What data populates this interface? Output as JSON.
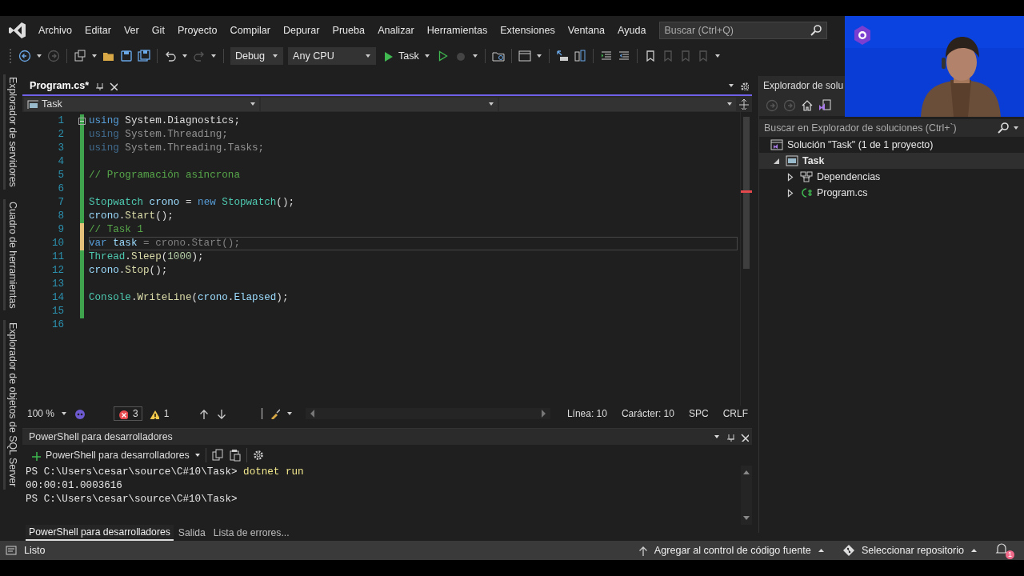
{
  "menu": [
    "Archivo",
    "Editar",
    "Ver",
    "Git",
    "Proyecto",
    "Compilar",
    "Depurar",
    "Prueba",
    "Analizar",
    "Herramientas",
    "Extensiones",
    "Ventana",
    "Ayuda"
  ],
  "search": {
    "placeholder": "Buscar (Ctrl+Q)"
  },
  "toolbar": {
    "configuration": "Debug",
    "platform": "Any CPU",
    "run_target": "Task"
  },
  "side_tabs": [
    "Explorador de servidores",
    "Cuadro de herramientas",
    "Explorador de objetos de SQL Server"
  ],
  "editor": {
    "tab": {
      "label": "Program.cs*",
      "selected": true
    },
    "nav": "Task",
    "lines": [
      {
        "number": "1",
        "color": "#3fa34d",
        "collapsible": true,
        "unused": false,
        "current": false,
        "tokens": [
          {
            "t": "using",
            "kind": "kw"
          },
          {
            "t": " System.Diagnostics;",
            "kind": "plain"
          }
        ]
      },
      {
        "number": "2",
        "color": "#3fa34d",
        "unused": true,
        "current": false,
        "tokens": [
          {
            "t": "using",
            "kind": "kw"
          },
          {
            "t": " System.Threading;",
            "kind": "plain"
          }
        ]
      },
      {
        "number": "3",
        "color": "#3fa34d",
        "unused": true,
        "current": false,
        "tokens": [
          {
            "t": "using",
            "kind": "kw"
          },
          {
            "t": " System.Threading.Tasks;",
            "kind": "plain"
          }
        ]
      },
      {
        "number": "4",
        "color": "#3fa34d"
      },
      {
        "number": "5",
        "color": "#3fa34d",
        "unused": false,
        "current": false,
        "tokens": [
          {
            "t": "// Programación asíncrona",
            "kind": "comment"
          }
        ]
      },
      {
        "number": "6",
        "color": "#3fa34d"
      },
      {
        "number": "7",
        "color": "#3fa34d",
        "unused": false,
        "current": false,
        "tokens": [
          {
            "t": "Stopwatch",
            "kind": "type"
          },
          {
            "t": " crono",
            "kind": "ident"
          },
          {
            "t": " = ",
            "kind": "plain"
          },
          {
            "t": "new",
            "kind": "kw"
          },
          {
            "t": " Stopwatch",
            "kind": "type"
          },
          {
            "t": "();",
            "kind": "plain"
          }
        ]
      },
      {
        "number": "8",
        "color": "#3fa34d",
        "unused": false,
        "current": false,
        "tokens": [
          {
            "t": "crono",
            "kind": "ident"
          },
          {
            "t": ".",
            "kind": "plain"
          },
          {
            "t": "Start",
            "kind": "method"
          },
          {
            "t": "();",
            "kind": "plain"
          }
        ]
      },
      {
        "number": "9",
        "color": "#e5c07b",
        "unused": false,
        "current": false,
        "tokens": [
          {
            "t": "// Task 1",
            "kind": "comment"
          }
        ]
      },
      {
        "number": "10",
        "color": "#e5c07b",
        "unused": false,
        "current": true,
        "tokens": [
          {
            "t": "var",
            "kind": "kw"
          },
          {
            "t": " task",
            "kind": "ident"
          },
          {
            "t": " = crono.Start();",
            "kind": "ghost"
          }
        ]
      },
      {
        "number": "11",
        "color": "#3fa34d",
        "unused": false,
        "current": false,
        "tokens": [
          {
            "t": "Thread",
            "kind": "type"
          },
          {
            "t": ".",
            "kind": "plain"
          },
          {
            "t": "Sleep",
            "kind": "method"
          },
          {
            "t": "(",
            "kind": "plain"
          },
          {
            "t": "1000",
            "kind": "num"
          },
          {
            "t": ");",
            "kind": "plain"
          }
        ]
      },
      {
        "number": "12",
        "color": "#3fa34d",
        "unused": false,
        "current": false,
        "tokens": [
          {
            "t": "crono",
            "kind": "ident"
          },
          {
            "t": ".",
            "kind": "plain"
          },
          {
            "t": "Stop",
            "kind": "method"
          },
          {
            "t": "();",
            "kind": "plain"
          }
        ]
      },
      {
        "number": "13",
        "color": "#3fa34d"
      },
      {
        "number": "14",
        "color": "#3fa34d",
        "unused": false,
        "current": false,
        "tokens": [
          {
            "t": "Console",
            "kind": "type"
          },
          {
            "t": ".",
            "kind": "plain"
          },
          {
            "t": "WriteLine",
            "kind": "method"
          },
          {
            "t": "(",
            "kind": "plain"
          },
          {
            "t": "crono",
            "kind": "ident"
          },
          {
            "t": ".",
            "kind": "plain"
          },
          {
            "t": "Elapsed",
            "kind": "ident"
          },
          {
            "t": ");",
            "kind": "plain"
          }
        ]
      },
      {
        "number": "15",
        "color": "#3fa34d"
      },
      {
        "number": "16"
      }
    ]
  },
  "editor_status": {
    "zoom": "100 %",
    "errors": "3",
    "warnings": "1",
    "line": "Línea: 10",
    "column": "Carácter: 10",
    "whitespace": "SPC",
    "eol": "CRLF"
  },
  "terminal": {
    "title": "PowerShell para desarrolladores",
    "profile": "PowerShell para desarrolladores",
    "output": [
      {
        "prompt": "PS C:\\Users\\cesar\\source\\C#10\\Task> ",
        "command": "dotnet run"
      },
      {
        "text": "00:00:01.0003616"
      },
      {
        "prompt": "PS C:\\Users\\cesar\\source\\C#10\\Task>"
      }
    ],
    "tabs": [
      {
        "label": "PowerShell para desarrolladores",
        "selected": true
      },
      {
        "label": "Salida",
        "selected": false
      },
      {
        "label": "Lista de errores...",
        "selected": false
      }
    ]
  },
  "solution_explorer": {
    "title": "Explorador de solu",
    "search": {
      "placeholder": "Buscar en Explorador de soluciones (Ctrl+`)"
    },
    "tree": [
      {
        "label": "Solución \"Task\" (1 de 1 proyecto)",
        "kind": "solution",
        "selected": false,
        "children": [
          {
            "label": "Task",
            "kind": "project",
            "expanded": true,
            "selected": true,
            "children": [
              {
                "label": "Dependencias",
                "kind": "dependencies",
                "expanded": false,
                "selected": false
              },
              {
                "label": "Program.cs",
                "kind": "file",
                "expanded": false,
                "selected": false
              }
            ]
          }
        ]
      }
    ]
  },
  "webcam": {
    "kind": "picture"
  },
  "status_bar": {
    "text": "Listo",
    "source_control": "Agregar al control de código fuente",
    "repository": "Seleccionar repositorio",
    "notifications": "1"
  }
}
